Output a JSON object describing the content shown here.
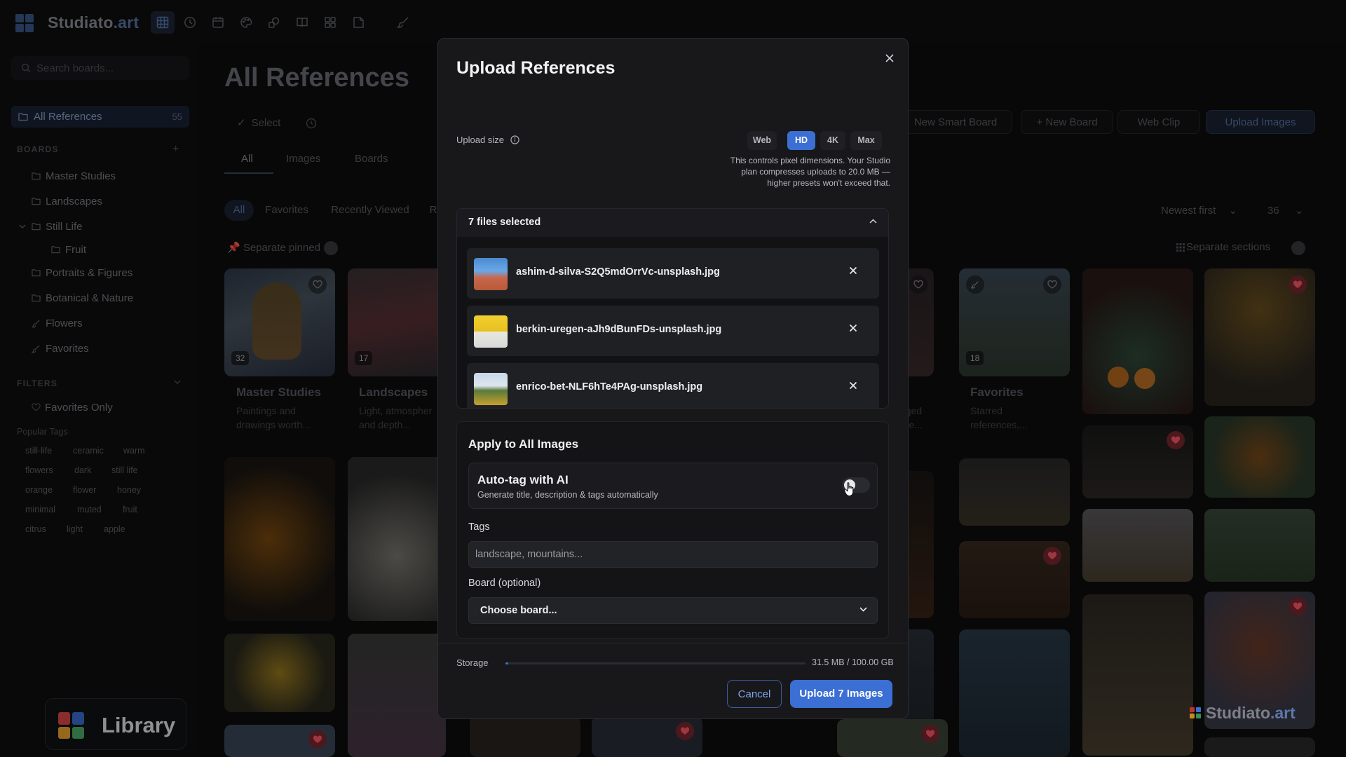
{
  "app": {
    "brand_main": "Studiato",
    "brand_ext": ".art",
    "accent": "#3b6fd4"
  },
  "toolbar": {
    "icons": [
      "grid-icon",
      "clock-icon",
      "calendar-icon",
      "palette-icon",
      "shapes-icon",
      "book-icon",
      "layout-icon",
      "note-icon",
      "brush-icon"
    ]
  },
  "sidebar": {
    "search_placeholder": "Search boards...",
    "all_label": "All References",
    "all_count": "55",
    "boards_heading": "BOARDS",
    "boards": [
      "Master Studies",
      "Landscapes",
      "Still Life",
      "Fruit",
      "Portraits & Figures",
      "Botanical & Nature",
      "Flowers",
      "Favorites"
    ],
    "filters_heading": "FILTERS",
    "favorites_only": "Favorites Only",
    "popular_tags_heading": "Popular Tags",
    "tags": [
      "still-life",
      "ceramic",
      "warm",
      "flowers",
      "dark",
      "still life",
      "orange",
      "flower",
      "honey",
      "minimal",
      "muted",
      "fruit",
      "citrus",
      "light",
      "apple"
    ],
    "library_label": "Library"
  },
  "main": {
    "title": "All References",
    "select_label": "Select",
    "tabs": [
      "All",
      "Images",
      "Boards"
    ],
    "actions": {
      "smart_board": "New Smart Board",
      "new_board": "New Board",
      "web_clip": "Web Clip",
      "upload": "Upload Images"
    },
    "filters": [
      "All",
      "Favorites",
      "Recently Viewed",
      "R"
    ],
    "sort": "Newest first",
    "per_page": "36",
    "separate_pinned": "Separate pinned",
    "separate_sections": "Separate sections",
    "cards": [
      {
        "title": "Master Studies",
        "desc1": "Paintings and",
        "desc2": "drawings worth...",
        "count": "32"
      },
      {
        "title": "Landscapes",
        "desc1": "Light, atmospher",
        "desc2": "and depth...",
        "count": "17"
      },
      {
        "title": "Favorites",
        "desc1": "Starred",
        "desc2": "references,...",
        "count": "18"
      }
    ],
    "partial_text1": "gged",
    "partial_text2": "ere..."
  },
  "modal": {
    "title": "Upload References",
    "upload_size_label": "Upload size",
    "sizes": [
      "Web",
      "HD",
      "4K",
      "Max"
    ],
    "selected_size": "HD",
    "size_note": "This controls pixel dimensions. Your Studio plan compresses uploads to 20.0 MB — higher presets won't exceed that.",
    "files_header": "7 files selected",
    "files": [
      "ashim-d-silva-S2Q5mdOrrVc-unsplash.jpg",
      "berkin-uregen-aJh9dBunFDs-unsplash.jpg",
      "enrico-bet-NLF6hTe4PAg-unsplash.jpg"
    ],
    "apply_title": "Apply to All Images",
    "autotag_title": "Auto-tag with AI",
    "autotag_sub": "Generate title, description & tags automatically",
    "autotag_on": false,
    "tags_label": "Tags",
    "tags_placeholder": "landscape, mountains...",
    "board_label": "Board (optional)",
    "board_value": "Choose board...",
    "storage_label": "Storage",
    "storage_value": "31.5 MB / 100.00 GB",
    "storage_fraction": 0.0003,
    "cancel": "Cancel",
    "upload_btn": "Upload 7 Images"
  },
  "watermark": {
    "main": "Studiato",
    "ext": ".art"
  }
}
